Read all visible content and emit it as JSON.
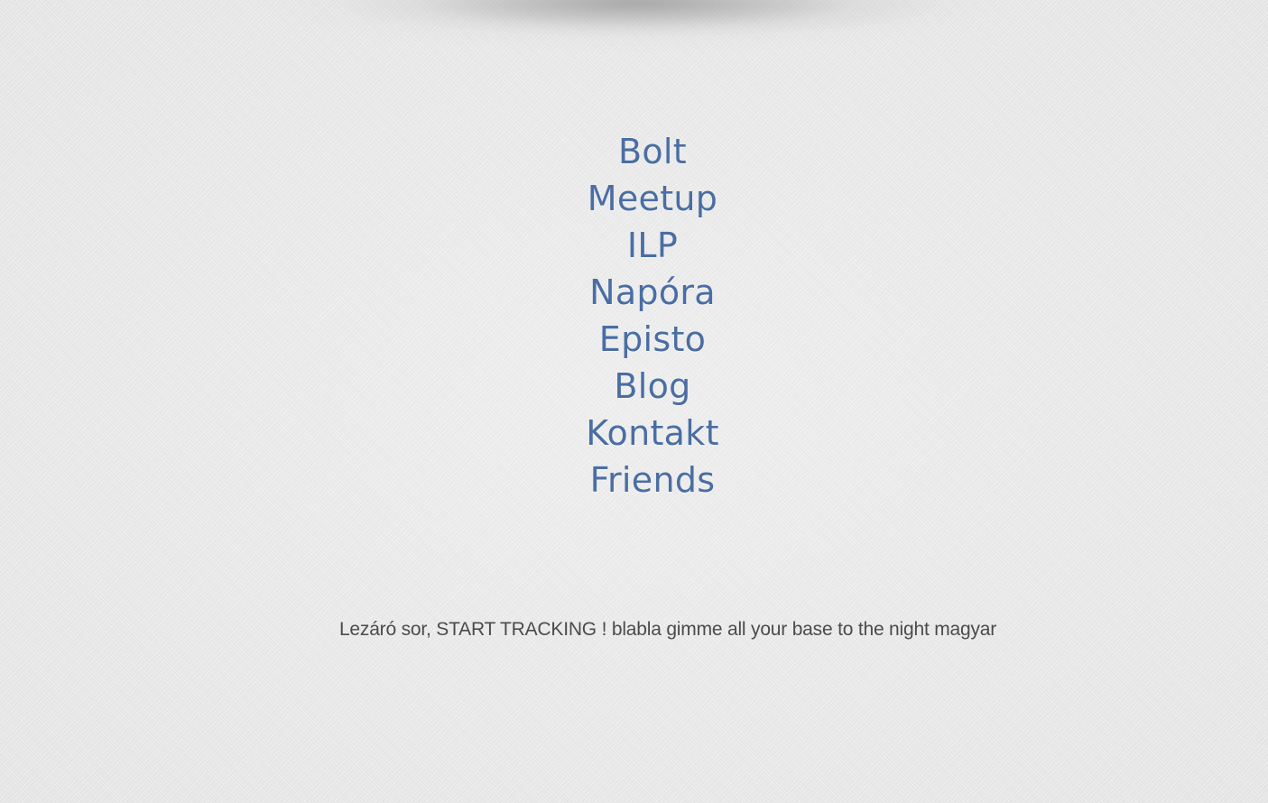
{
  "nav": {
    "items": [
      {
        "label": "Bolt"
      },
      {
        "label": "Meetup"
      },
      {
        "label": "ILP"
      },
      {
        "label": "Napóra"
      },
      {
        "label": "Episto"
      },
      {
        "label": "Blog"
      },
      {
        "label": "Kontakt"
      },
      {
        "label": "Friends"
      }
    ]
  },
  "footer": {
    "text": "Lezáró sor, START TRACKING ! blabla gimme all your base to the night magyar"
  },
  "colors": {
    "link": "#4a6ea3",
    "footer_text": "#4b4b4b",
    "background": "#ececec"
  }
}
